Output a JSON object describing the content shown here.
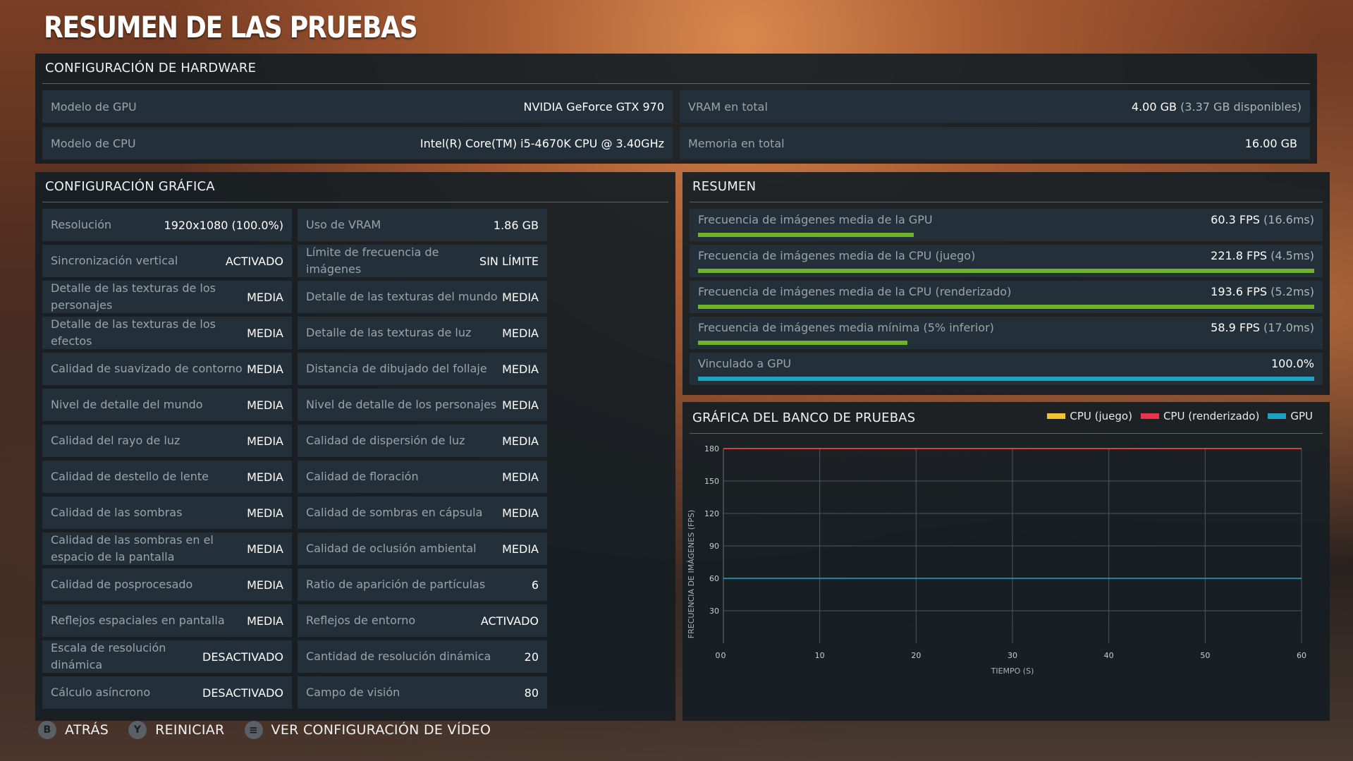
{
  "page_title": "RESUMEN DE LAS PRUEBAS",
  "hardware": {
    "title": "CONFIGURACIÓN DE HARDWARE",
    "gpu_model": {
      "label": "Modelo de GPU",
      "value": "NVIDIA GeForce GTX 970"
    },
    "cpu_model": {
      "label": "Modelo de CPU",
      "value": "Intel(R) Core(TM) i5-4670K CPU @ 3.40GHz"
    },
    "vram_total": {
      "label": "VRAM en total",
      "value": "4.00 GB",
      "sub": "(3.37 GB disponibles)"
    },
    "memory_total": {
      "label": "Memoria en total",
      "value": "16.00 GB"
    }
  },
  "graphics": {
    "title": "CONFIGURACIÓN GRÁFICA",
    "left": [
      {
        "label": "Resolución",
        "value": "1920x1080 (100.0%)"
      },
      {
        "label": "Sincronización vertical",
        "value": "ACTIVADO"
      },
      {
        "label": "Detalle de las texturas de los personajes",
        "value": "MEDIA"
      },
      {
        "label": "Detalle de las texturas de los efectos",
        "value": "MEDIA"
      },
      {
        "label": "Calidad de suavizado de contorno",
        "value": "MEDIA"
      },
      {
        "label": "Nivel de detalle del mundo",
        "value": "MEDIA"
      },
      {
        "label": "Calidad del rayo de luz",
        "value": "MEDIA"
      },
      {
        "label": "Calidad de destello de lente",
        "value": "MEDIA"
      },
      {
        "label": "Calidad de las sombras",
        "value": "MEDIA"
      },
      {
        "label": "Calidad de las sombras en el espacio de la pantalla",
        "value": "MEDIA"
      },
      {
        "label": "Calidad de posprocesado",
        "value": "MEDIA"
      },
      {
        "label": "Reflejos espaciales en pantalla",
        "value": "MEDIA"
      },
      {
        "label": "Escala de resolución dinámica",
        "value": "DESACTIVADO"
      },
      {
        "label": "Cálculo asíncrono",
        "value": "DESACTIVADO"
      }
    ],
    "right": [
      {
        "label": "Uso de VRAM",
        "value": "1.86 GB"
      },
      {
        "label": "Límite de frecuencia de imágenes",
        "value": "SIN LÍMITE"
      },
      {
        "label": "Detalle de las texturas del mundo",
        "value": "MEDIA"
      },
      {
        "label": "Detalle de las texturas de luz",
        "value": "MEDIA"
      },
      {
        "label": "Distancia de dibujado del follaje",
        "value": "MEDIA"
      },
      {
        "label": "Nivel de detalle de los personajes",
        "value": "MEDIA"
      },
      {
        "label": "Calidad de dispersión de luz",
        "value": "MEDIA"
      },
      {
        "label": "Calidad de floración",
        "value": "MEDIA"
      },
      {
        "label": "Calidad de sombras en cápsula",
        "value": "MEDIA"
      },
      {
        "label": "Calidad de oclusión ambiental",
        "value": "MEDIA"
      },
      {
        "label": "Ratio de aparición de partículas",
        "value": "6"
      },
      {
        "label": "Reflejos de entorno",
        "value": "ACTIVADO"
      },
      {
        "label": "Cantidad de resolución dinámica",
        "value": "20"
      },
      {
        "label": "Campo de visión",
        "value": "80"
      }
    ]
  },
  "summary": {
    "title": "RESUMEN",
    "rows": [
      {
        "label": "Frecuencia de imágenes media de la GPU",
        "value": "60.3 FPS",
        "sub": "(16.6ms)",
        "fill": 0.35,
        "color": "#6fb327"
      },
      {
        "label": "Frecuencia de imágenes media de la CPU (juego)",
        "value": "221.8 FPS",
        "sub": "(4.5ms)",
        "fill": 1.0,
        "color": "#6fb327"
      },
      {
        "label": "Frecuencia de imágenes media de la CPU (renderizado)",
        "value": "193.6 FPS",
        "sub": "(5.2ms)",
        "fill": 1.0,
        "color": "#6fb327"
      },
      {
        "label": "Frecuencia de imágenes media mínima (5% inferior)",
        "value": "58.9 FPS",
        "sub": "(17.0ms)",
        "fill": 0.34,
        "color": "#6fb327"
      },
      {
        "label": "Vinculado a GPU",
        "value": "100.0%",
        "sub": "",
        "fill": 1.0,
        "color": "#1aa3c4"
      }
    ]
  },
  "chart": {
    "title": "GRÁFICA DEL BANCO DE PRUEBAS",
    "legend": [
      {
        "name": "CPU (juego)",
        "color": "#f2c230"
      },
      {
        "name": "CPU (renderizado)",
        "color": "#e8334a"
      },
      {
        "name": "GPU",
        "color": "#1aa3c4"
      }
    ]
  },
  "chart_data": {
    "type": "scatter",
    "title": "GRÁFICA DEL BANCO DE PRUEBAS",
    "xlabel": "TIEMPO (S)",
    "ylabel": "FRECUENCIA DE IMÁGENES (FPS)",
    "xlim": [
      0,
      60
    ],
    "ylim": [
      0,
      180
    ],
    "x_ticks": [
      0,
      10,
      20,
      30,
      40,
      50,
      60
    ],
    "y_ticks": [
      30,
      60,
      90,
      120,
      150,
      180
    ],
    "grid": true,
    "legend_position": "top-right",
    "series": [
      {
        "name": "CPU (juego)",
        "color": "#f2c230",
        "x": [
          0,
          60
        ],
        "y": [
          180,
          180
        ]
      },
      {
        "name": "CPU (renderizado)",
        "color": "#e8334a",
        "x": [
          0,
          60
        ],
        "y": [
          180,
          180
        ]
      },
      {
        "name": "GPU",
        "color": "#1aa3c4",
        "x": [
          0,
          60
        ],
        "y": [
          60,
          60
        ]
      }
    ]
  },
  "footer": {
    "back": {
      "glyph": "B",
      "label": "ATRÁS"
    },
    "restart": {
      "glyph": "Y",
      "label": "REINICIAR"
    },
    "video": {
      "glyph": "≡",
      "label": "VER CONFIGURACIÓN DE VÍDEO"
    }
  }
}
